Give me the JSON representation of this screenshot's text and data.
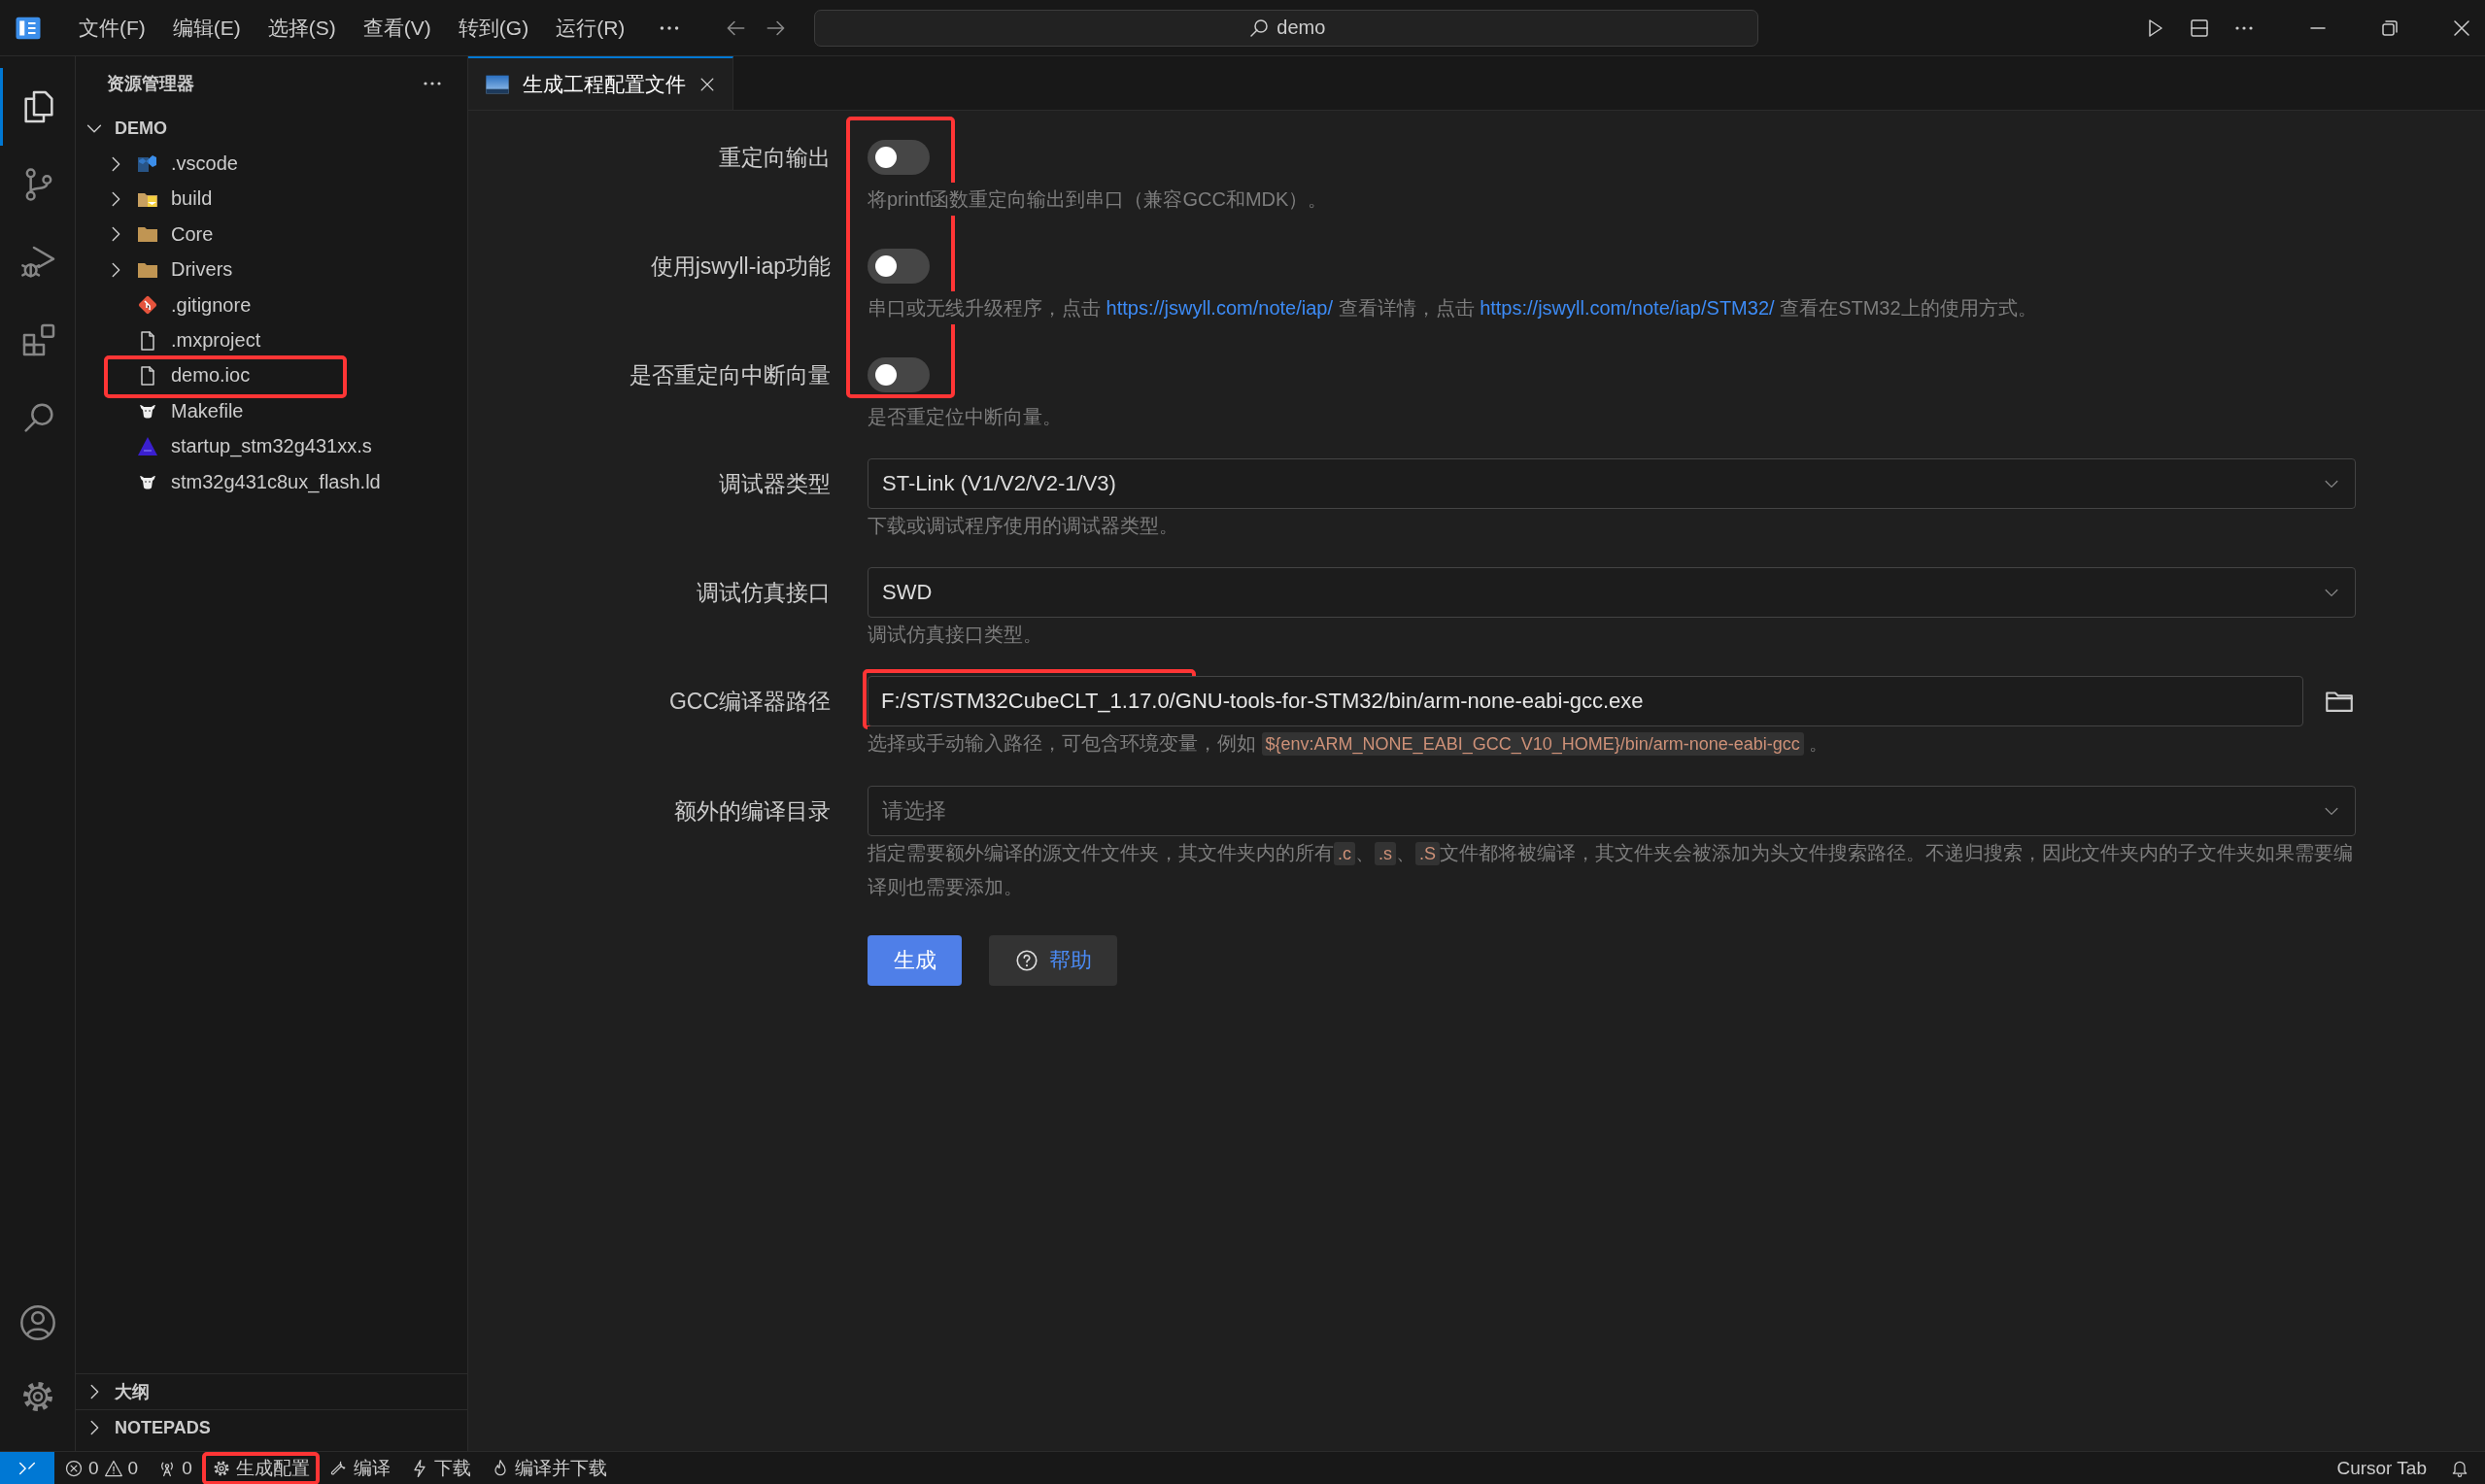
{
  "titlebar": {
    "menus": [
      "文件(F)",
      "编辑(E)",
      "选择(S)",
      "查看(V)",
      "转到(G)",
      "运行(R)"
    ],
    "search": {
      "value": "demo"
    }
  },
  "activity": [
    {
      "kind": "explorer",
      "selected": true
    },
    {
      "kind": "scm",
      "selected": false
    },
    {
      "kind": "debug",
      "selected": false
    },
    {
      "kind": "extensions",
      "selected": false
    },
    {
      "kind": "search",
      "selected": false
    }
  ],
  "explorer": {
    "title": "资源管理器",
    "root": {
      "label": "DEMO",
      "expanded": true,
      "children": [
        {
          "label": ".vscode",
          "kind": "vscode",
          "expanded": false,
          "highlighted": false
        },
        {
          "label": "build",
          "kind": "build",
          "expanded": false,
          "highlighted": false
        },
        {
          "label": "Core",
          "kind": "folder",
          "expanded": false,
          "highlighted": false
        },
        {
          "label": "Drivers",
          "kind": "folder",
          "expanded": false,
          "highlighted": false
        },
        {
          "label": ".gitignore",
          "kind": "git",
          "highlighted": false
        },
        {
          "label": ".mxproject",
          "kind": "file",
          "highlighted": false
        },
        {
          "label": "demo.ioc",
          "kind": "file",
          "highlighted": true
        },
        {
          "label": "Makefile",
          "kind": "gnu",
          "highlighted": false
        },
        {
          "label": "startup_stm32g431xx.s",
          "kind": "asm",
          "highlighted": false
        },
        {
          "label": "stm32g431c8ux_flash.ld",
          "kind": "gnu",
          "highlighted": false
        }
      ]
    },
    "panels": [
      {
        "label": "大纲",
        "expanded": false
      },
      {
        "label": "NOTEPADS",
        "expanded": false
      }
    ]
  },
  "tabs": [
    {
      "label": "生成工程配置文件",
      "selected": true
    }
  ],
  "form": {
    "toggles_highlighted": true,
    "fields": [
      {
        "kind": "toggle",
        "label": "重定向输出",
        "on": false,
        "hint": [
          {
            "kind": "text",
            "text": "将printf函数重定向输出到串口（兼容GCC和MDK）。"
          }
        ]
      },
      {
        "kind": "toggle",
        "label": "使用jswyll-iap功能",
        "on": false,
        "hint": [
          {
            "kind": "text",
            "text": "串口或无线升级程序，点击 "
          },
          {
            "kind": "link",
            "text": "https://jswyll.com/note/iap/"
          },
          {
            "kind": "text",
            "text": " 查看详情，点击 "
          },
          {
            "kind": "link",
            "text": "https://jswyll.com/note/iap/STM32/"
          },
          {
            "kind": "text",
            "text": " 查看在STM32上的使用方式。"
          }
        ]
      },
      {
        "kind": "toggle",
        "label": "是否重定向中断向量",
        "on": false,
        "hint": [
          {
            "kind": "text",
            "text": "是否重定位中断向量。"
          }
        ]
      },
      {
        "kind": "select",
        "label": "调试器类型",
        "value": "ST-Link (V1/V2/V2-1/V3)",
        "hint": [
          {
            "kind": "text",
            "text": "下载或调试程序使用的调试器类型。"
          }
        ]
      },
      {
        "kind": "select",
        "label": "调试仿真接口",
        "value": "SWD",
        "hint": [
          {
            "kind": "text",
            "text": "调试仿真接口类型。"
          }
        ]
      },
      {
        "kind": "path",
        "label": "GCC编译器路径",
        "value": "F:/ST/STM32CubeCLT_1.17.0/GNU-tools-for-STM32/bin/arm-none-eabi-gcc.exe",
        "highlighted": true,
        "hint": [
          {
            "kind": "text",
            "text": "选择或手动输入路径，可包含环境变量，例如 "
          },
          {
            "kind": "code",
            "text": "${env:ARM_NONE_EABI_GCC_V10_HOME}/bin/arm-none-eabi-gcc"
          },
          {
            "kind": "text",
            "text": " 。"
          }
        ]
      },
      {
        "kind": "select",
        "label": "额外的编译目录",
        "placeholder": "请选择",
        "hint": [
          {
            "kind": "text",
            "text": "指定需要额外编译的源文件文件夹，其文件夹内的所有"
          },
          {
            "kind": "code",
            "text": ".c"
          },
          {
            "kind": "text",
            "text": "、"
          },
          {
            "kind": "code",
            "text": ".s"
          },
          {
            "kind": "text",
            "text": "、"
          },
          {
            "kind": "code",
            "text": ".S"
          },
          {
            "kind": "text",
            "text": "文件都将被编译，其文件夹会被添加为头文件搜索路径。不递归搜索，因此文件夹内的子文件夹如果需要编译则也需要添加。"
          }
        ]
      }
    ],
    "buttons": [
      {
        "kind": "primary",
        "label": "生成"
      },
      {
        "kind": "help",
        "label": "帮助"
      }
    ]
  },
  "statusbar": {
    "left": [
      {
        "kind": "problems",
        "errors": "0",
        "warnings": "0",
        "highlighted": false
      },
      {
        "kind": "ports",
        "text": "0",
        "highlighted": false
      },
      {
        "kind": "generate",
        "text": "生成配置",
        "highlighted": true
      },
      {
        "kind": "compile",
        "text": "编译",
        "highlighted": false
      },
      {
        "kind": "download",
        "text": "下载",
        "highlighted": false
      },
      {
        "kind": "flame",
        "text": "编译并下载",
        "highlighted": false
      }
    ],
    "right": [
      {
        "kind": "text",
        "text": "Cursor Tab"
      },
      {
        "kind": "bell"
      }
    ]
  }
}
